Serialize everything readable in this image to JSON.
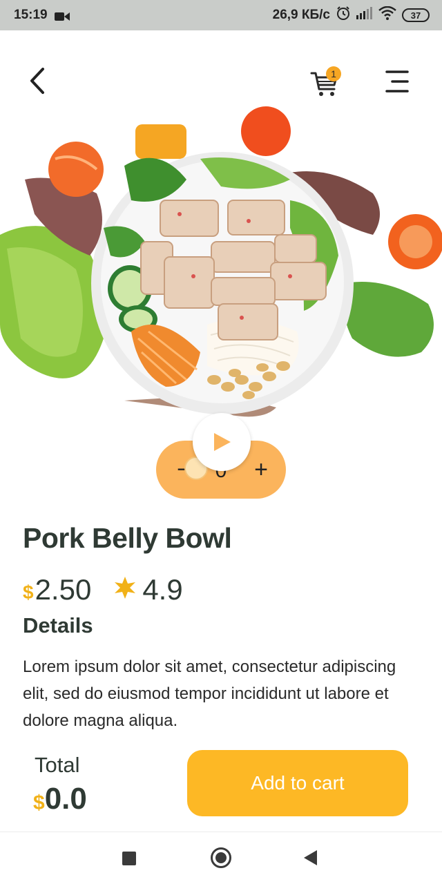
{
  "status_bar": {
    "time": "15:19",
    "network_speed": "26,9 КБ/с",
    "battery": "37",
    "icons": [
      "video-camera-icon",
      "alarm-icon",
      "signal-icon",
      "wifi-icon",
      "battery-icon"
    ]
  },
  "header": {
    "cart_count": "1",
    "icons": [
      "back-arrow-icon",
      "cart-icon",
      "menu-icon"
    ]
  },
  "product": {
    "image_description_icon": "salad-bowl-image",
    "name": "Pork Belly Bowl",
    "currency": "$",
    "price": "2.50",
    "rating": "4.9",
    "details_label": "Details",
    "description": "Lorem ipsum dolor sit amet, consectetur adipiscing elit, sed do eiusmod tempor incididunt ut labore et dolore magna aliqua."
  },
  "quantity": {
    "minus": "−",
    "value": "0",
    "plus": "+"
  },
  "footer": {
    "total_label": "Total",
    "currency": "$",
    "total_value": "0.0",
    "add_to_cart_label": "Add to cart"
  },
  "colors": {
    "accent": "#fdb825",
    "pill": "#fbb45c",
    "currency": "#f1b118",
    "badge": "#f6a623",
    "text": "#2f3a34"
  }
}
